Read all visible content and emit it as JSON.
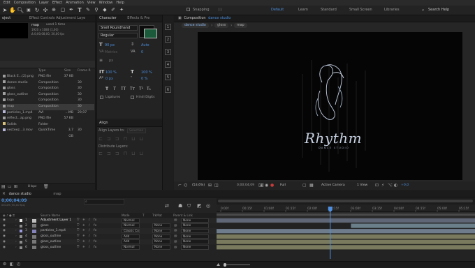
{
  "menu": [
    "Edit",
    "Composition",
    "Layer",
    "Effect",
    "Animation",
    "View",
    "Window",
    "Help"
  ],
  "toolbar": {
    "snapping_label": "Snapping",
    "workspaces": [
      "Default",
      "Learn",
      "Standard",
      "Small Screen",
      "Libraries"
    ],
    "active_workspace": "Default",
    "search_help_label": "Search Help"
  },
  "project": {
    "tab_label": "oject",
    "effect_controls_label": "Effect Controls Adjustment Laye",
    "selected_name": "map",
    "used_label": "used 1 time",
    "info_line1": "1920 x 1080 (1,00)",
    "info_line2": "Δ 0;00;08;00, 30,00 fps",
    "columns": {
      "type": "Type",
      "size": "Size",
      "frame": "Frame R"
    },
    "items": [
      {
        "name": "Black E...(2).png",
        "type": "PNG file",
        "size": "37 KB",
        "frame": "",
        "color": "#9e9e9e"
      },
      {
        "name": "dance studio",
        "type": "Composition",
        "size": "",
        "frame": "30",
        "color": "#a0a0a0"
      },
      {
        "name": "gloss",
        "type": "Composition",
        "size": "",
        "frame": "30",
        "color": "#a0a0a0"
      },
      {
        "name": "gloss_outline",
        "type": "Composition",
        "size": "",
        "frame": "30",
        "color": "#a0a0a0"
      },
      {
        "name": "logo",
        "type": "Composition",
        "size": "",
        "frame": "30",
        "color": "#a0a0a0"
      },
      {
        "name": "map",
        "type": "Composition",
        "size": "",
        "frame": "30",
        "color": "#a0a0a0"
      },
      {
        "name": "particles_1.mp4",
        "type": "AVI",
        "size": "...MB",
        "frame": "29,97",
        "color": "#b7b7d8"
      },
      {
        "name": "reflect...ap.png",
        "type": "PNG file",
        "size": "57 KB",
        "frame": "",
        "color": "#9e9e9e"
      },
      {
        "name": "Solids",
        "type": "Folder",
        "size": "",
        "frame": "",
        "color": "#d8c07a"
      },
      {
        "name": "vecteez...3.mov",
        "type": "QuickTime",
        "size": "3,7 GB",
        "frame": "30",
        "color": "#b7b7d8"
      }
    ],
    "bpc_label": "8 bpc"
  },
  "character": {
    "tab_label": "Character",
    "effects_tab_label": "Effects & Pre",
    "font_name": "Snell Roundhand",
    "font_style": "Regular",
    "size_value": "90 px",
    "leading_value": "Auto",
    "tracking_value": "0",
    "kerning_value": "Metrics",
    "stroke_width": "px",
    "vscale": "100 %",
    "hscale": "100 %",
    "baseline": "0 px",
    "tsume": "0 %",
    "style_buttons": [
      "T",
      "T",
      "TT",
      "Tᴛ",
      "T¹",
      "T₁"
    ],
    "ligatures_label": "Ligatures",
    "hindi_digits_label": "Hindi Digits"
  },
  "align": {
    "tab_label": "Align",
    "align_layers_to": "Align Layers to:",
    "selection_value": "Selection",
    "distribute_label": "Distribute Layers:"
  },
  "composition": {
    "tab_prefix": "Composition",
    "tab_name": "dance studio",
    "breadcrumbs": [
      "dance studio",
      "gloss",
      "map"
    ],
    "logo_title": "Rhythm",
    "logo_subtitle": "DANCE STUDIO",
    "footer": {
      "zoom": "(53,6%)",
      "timecode": "0;00;04;09",
      "resolution": "Full",
      "camera": "Active Camera",
      "views": "1 View",
      "offset": "+0,0"
    }
  },
  "timeline": {
    "tab_label": "dance studio",
    "tab2_label": "map",
    "timecode": "0;00;04;09",
    "frame_info": "00129 (30,00 fps)",
    "columns": {
      "source": "Source Name",
      "mode": "Mode",
      "t": "T",
      "trkmat": "TrkMat",
      "parent": "Parent & Link"
    },
    "ruler_labels": [
      "0:00f",
      "00:15f",
      "01:00f",
      "01:15f",
      "02:00f",
      "02:15f",
      "03:00f",
      "03:15f",
      "04:00f",
      "04:15f",
      "05:00f",
      "05:15f",
      "06:00f",
      "06:15f",
      "07:00f",
      "07:15f"
    ],
    "layers": [
      {
        "num": "1",
        "name": "Adjustment Layer 1",
        "mode": "Normal",
        "trkmat": "",
        "parent": "None",
        "color": "#e6e6e6",
        "bar_color": "#5f6675",
        "bar_start": 0,
        "bar_end": 1,
        "highlight": true
      },
      {
        "num": "2",
        "name": "gloss",
        "mode": "Normal",
        "trkmat": "None",
        "parent": "None",
        "color": "#8d8d8d",
        "bar_color": "#6a7f8a",
        "bar_start": 0.52,
        "bar_end": 1
      },
      {
        "num": "3",
        "name": "particles_1.mp4",
        "mode": "Classic Co",
        "trkmat": "None",
        "parent": "None",
        "color": "#9b9be0",
        "bar_color": "#6f7c8c",
        "bar_start": 0,
        "bar_end": 1
      },
      {
        "num": "4",
        "name": "gloss_outline",
        "mode": "Add",
        "trkmat": "None",
        "parent": "None",
        "color": "#8d8d8d",
        "bar_color": "#7a7a5e",
        "bar_start": 0,
        "bar_end": 1
      },
      {
        "num": "5",
        "name": "gloss_outline",
        "mode": "Add",
        "trkmat": "None",
        "parent": "None",
        "color": "#8d8d8d",
        "bar_color": "#7a7a5e",
        "bar_start": 0,
        "bar_end": 1
      },
      {
        "num": "6",
        "name": "gloss_outline",
        "mode": "Normal",
        "trkmat": "None",
        "parent": "None",
        "color": "#8d8d8d",
        "bar_color": "#7a7a5e",
        "bar_start": 0,
        "bar_end": 1
      }
    ],
    "playhead": 0.44
  },
  "colors": {
    "accent": "#4b8dda",
    "playhead": "#4f8fe0"
  }
}
